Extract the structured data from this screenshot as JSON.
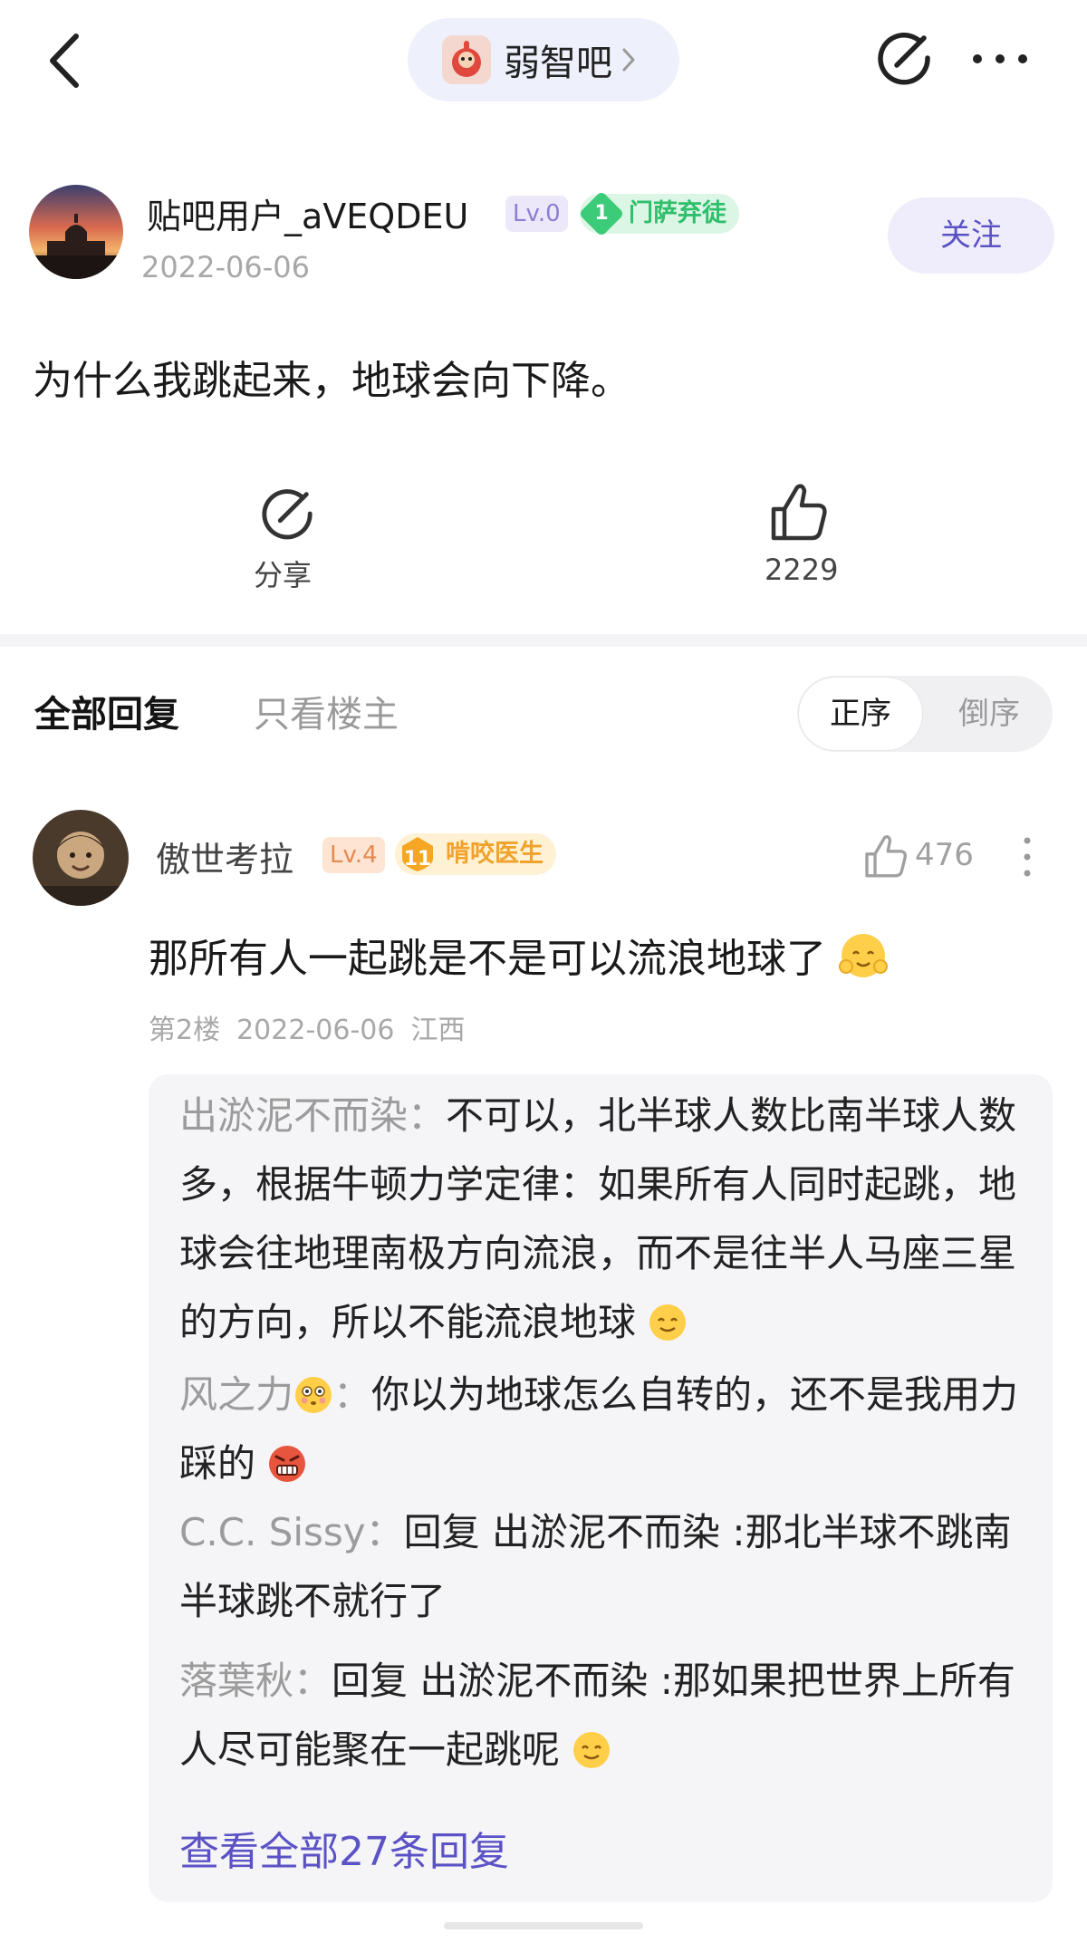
{
  "topbar": {
    "forum_name": "弱智吧"
  },
  "post": {
    "author": "贴吧用户_aVEQDEU",
    "level": "Lv.0",
    "fan_level": "1",
    "fan_title": "门萨弃徒",
    "date": "2022-06-06",
    "follow_label": "关注",
    "text": "为什么我跳起来，地球会向下降。",
    "share_label": "分享",
    "like_count": "2229"
  },
  "tabs": {
    "all": "全部回复",
    "op_only": "只看楼主"
  },
  "sort": {
    "asc": "正序",
    "desc": "倒序"
  },
  "comment": {
    "author": "傲世考拉",
    "level": "Lv.4",
    "fan_level": "11",
    "fan_title": "啃咬医生",
    "likes": "476",
    "text": "那所有人一起跳是不是可以流浪地球了",
    "floor": "第2楼",
    "date": "2022-06-06",
    "location": "江西",
    "replies": [
      {
        "user": "出淤泥不而染",
        "sep": "：",
        "text": "不可以，北半球人数比南半球人数多，根据牛顿力学定律：如果所有人同时起跳，地球会往地理南极方向流浪，而不是往半人马座三星的方向，所以不能流浪地球"
      },
      {
        "user": "风之力",
        "sep": "：",
        "text": "你以为地球怎么自转的，还不是我用力踩的"
      },
      {
        "user": "C.C. Sissy",
        "sep": "：",
        "text": "回复 出淤泥不而染 :那北半球不跳南半球跳不就行了"
      },
      {
        "user": "落葉秋",
        "sep": "：",
        "text": "回复 出淤泥不而染 :那如果把世界上所有人尽可能聚在一起跳呢"
      }
    ],
    "view_all": "查看全部27条回复"
  },
  "colors": {
    "accent": "#5b52c6",
    "fan_green": "#3ccb79",
    "fan_orange": "#f5a623"
  },
  "icons": [
    "back-icon",
    "chevron-right-icon",
    "share-icon",
    "more-icon",
    "thumb-up-icon",
    "more-vertical-icon"
  ]
}
